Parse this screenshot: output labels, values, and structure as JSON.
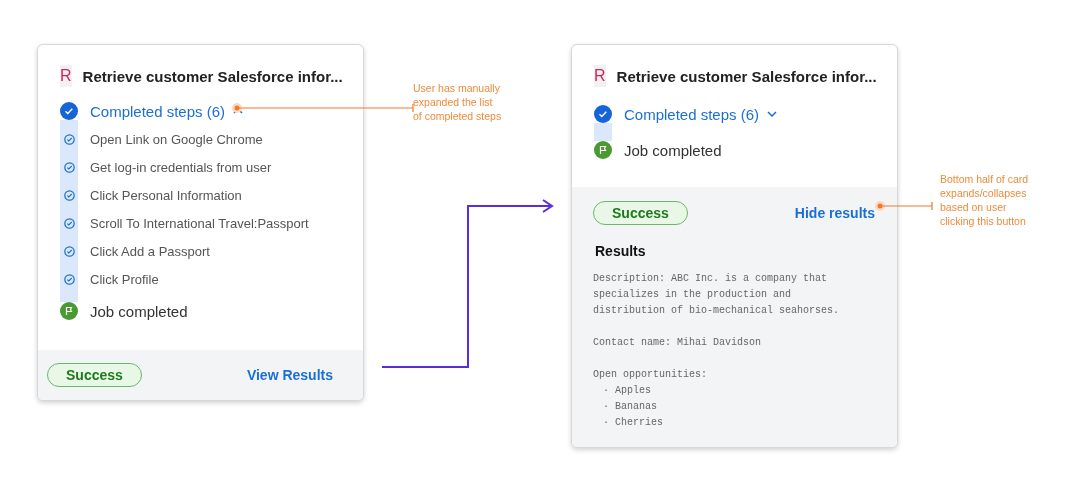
{
  "cards": [
    {
      "app_icon": "R",
      "title": "Retrieve customer Salesforce infor...",
      "completed_steps": "Completed steps (6)",
      "expanded": true,
      "steps": [
        "Open Link on Google Chrome",
        "Get log-in credentials from user",
        "Click Personal Information",
        "Scroll To International Travel:Passport",
        "Click Add a Passport",
        "Click Profile"
      ],
      "final_step": "Job completed",
      "status": "Success",
      "results_button": "View Results",
      "results_shown": false
    },
    {
      "app_icon": "R",
      "title": "Retrieve customer Salesforce infor...",
      "completed_steps": "Completed steps (6)",
      "expanded": false,
      "final_step": "Job completed",
      "status": "Success",
      "results_button": "Hide results",
      "results_shown": true,
      "results": {
        "heading": "Results",
        "description": "Description: ABC Inc. is a company that specializes in the production and distribution of bio-mechanical seahorses.",
        "contact": "Contact name: Mihai Davidson",
        "opportunities_label": "Open opportunities:",
        "opportunities": [
          "· Apples",
          "· Bananas",
          "· Cherries"
        ]
      }
    }
  ],
  "annotations": [
    {
      "text": "User has manually expanded the list of completed steps"
    },
    {
      "text": "Bottom half of card expands/collapses based on user clicking this button"
    }
  ]
}
